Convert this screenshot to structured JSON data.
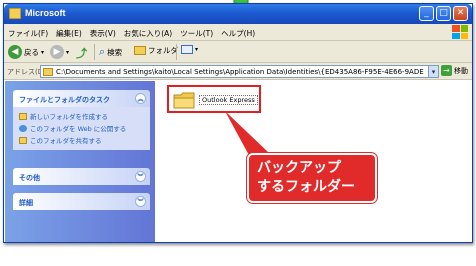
{
  "window": {
    "title": "Microsoft"
  },
  "menu": {
    "items": [
      "ファイル(F)",
      "編集(E)",
      "表示(V)",
      "お気に入り(A)",
      "ツール(T)",
      "ヘルプ(H)"
    ]
  },
  "toolbar": {
    "back_label": "戻る",
    "search_label": "検索",
    "folders_label": "フォルダ"
  },
  "address": {
    "label": "アドレス(D)",
    "value": "C:\\Documents and Settings\\kaito\\Local Settings\\Application Data\\Identities\\{ED435A86-F95E-4E66-9ADE",
    "go_label": "移動"
  },
  "taskpane": {
    "sections": [
      {
        "title": "ファイルとフォルダのタスク",
        "links": [
          "新しいフォルダを作成する",
          "このフォルダを Web に公開する",
          "このフォルダを共有する"
        ]
      },
      {
        "title": "その他",
        "links": []
      },
      {
        "title": "詳細",
        "links": []
      }
    ]
  },
  "main": {
    "folder_name": "Outlook Express"
  },
  "annotation": {
    "line1": "バックアップ",
    "line2": "するフォルダー"
  },
  "colors": {
    "accent_red": "#e12a2a",
    "titlebar_blue": "#1c5ad1",
    "arrow_green": "#3cc23c"
  }
}
